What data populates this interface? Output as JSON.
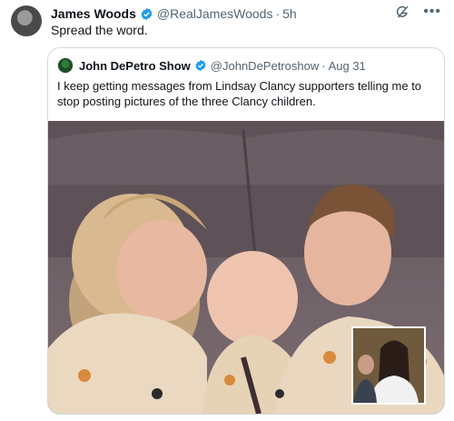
{
  "tweet": {
    "author_name": "James Woods",
    "handle": "@RealJamesWoods",
    "separator": "·",
    "time": "5h",
    "text": "Spread the word."
  },
  "quoted": {
    "author_name": "John DePetro Show",
    "handle": "@JohnDePetroshow",
    "separator": "·",
    "date": "Aug 31",
    "text": "I keep getting messages from Lindsay Clancy supporters telling me to stop posting pictures of the three Clancy children."
  },
  "icons": {
    "verified": "verified-badge-icon",
    "grok": "grok-icon",
    "more": "more-options-icon"
  },
  "colors": {
    "verified_blue": "#1d9bf0",
    "secondary_text": "#536471"
  }
}
